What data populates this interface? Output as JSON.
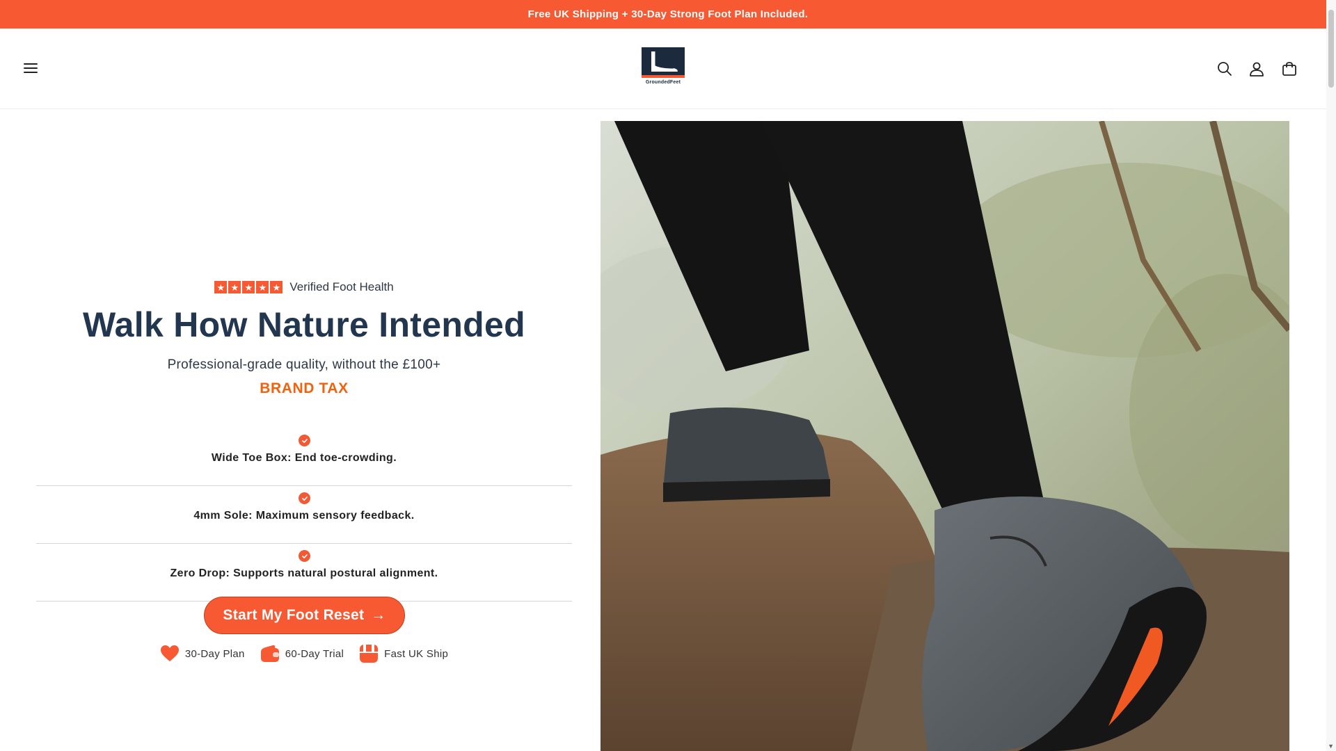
{
  "announcement": "Free UK Shipping + 30-Day Strong Foot Plan Included.",
  "header": {
    "logo_text": "GroundedFeet",
    "icons": [
      "menu-icon",
      "search-icon",
      "account-icon",
      "cart-icon"
    ]
  },
  "hero": {
    "rating_stars": "5",
    "rating_label": "Verified Foot Health",
    "headline": "Walk How Nature Intended",
    "subline": "Professional-grade quality, without the £100+",
    "highlight": "BRAND TAX",
    "features": [
      "Wide Toe Box: End toe-crowding.",
      "4mm Sole: Maximum sensory feedback.",
      "Zero Drop: Supports natural postural alignment."
    ],
    "cta_label": "Start My Foot Reset",
    "cta_arrow": "→",
    "badges": [
      {
        "icon": "heart-icon",
        "label": "30-Day Plan"
      },
      {
        "icon": "wallet-icon",
        "label": "60-Day Trial"
      },
      {
        "icon": "box-icon",
        "label": "Fast UK Ship"
      }
    ]
  },
  "colors": {
    "accent": "#f75a33",
    "headline": "#22364f",
    "highlight": "#f0620d"
  }
}
